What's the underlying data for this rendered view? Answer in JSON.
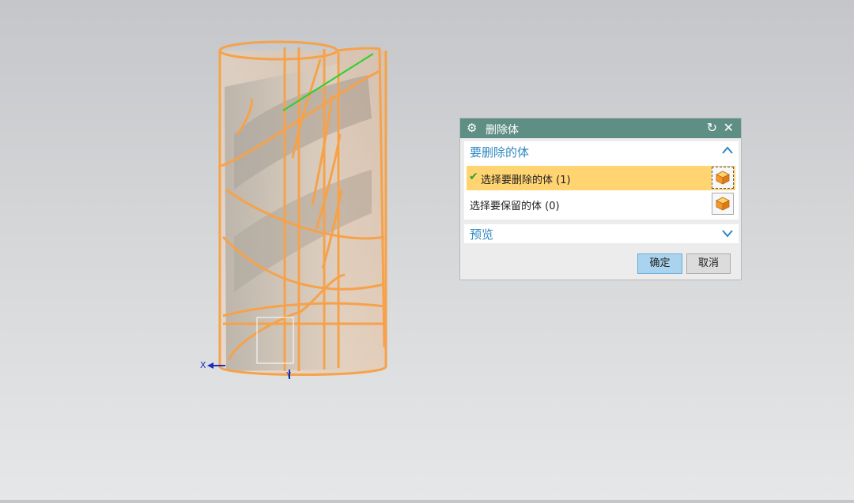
{
  "dialog": {
    "title": "删除体",
    "sections": {
      "bodies": {
        "label": "要删除的体",
        "delete_row": "选择要删除的体 (1)",
        "keep_row": "选择要保留的体 (0)"
      },
      "preview": {
        "label": "预览"
      }
    },
    "ok_label": "确定",
    "cancel_label": "取消"
  },
  "triad": {
    "x_label": "X",
    "y_label": "Y"
  },
  "icons": {
    "gear": "gear-icon",
    "reset": "reset-icon",
    "close": "close-icon",
    "collapse": "chevron-up-icon",
    "expand": "chevron-down-icon",
    "check": "check-icon",
    "body": "solid-body-cube-icon"
  },
  "colors": {
    "title_bar": "#5f8f84",
    "section_label": "#2e88c0",
    "selected_row": "#ffd471",
    "body_highlight": "#f6a24b",
    "ok_button": "#a9d3ef"
  }
}
